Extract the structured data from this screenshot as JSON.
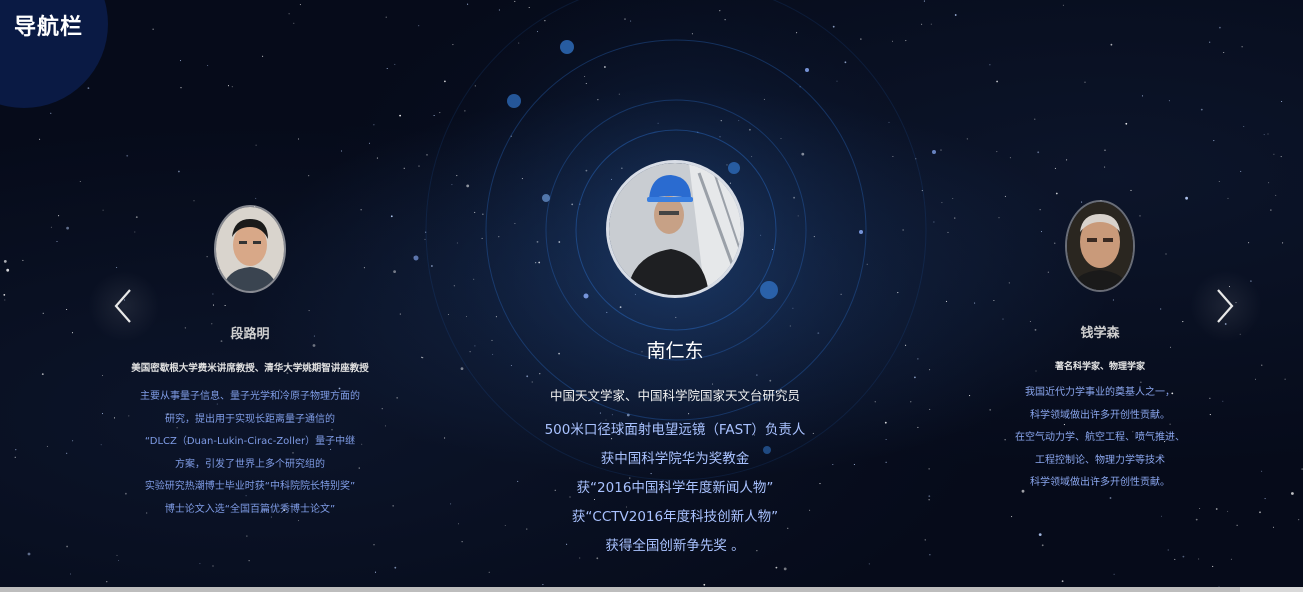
{
  "nav": {
    "title": "导航栏"
  },
  "colors": {
    "background": "#060b1a",
    "nav_badge": "#0a1a44",
    "desc_text": "#a9c2ff",
    "orbit": "#2a6cc8"
  },
  "icons": {
    "prev": "chevron-left-icon",
    "next": "chevron-right-icon"
  },
  "cards": {
    "left": {
      "name": "段路明",
      "role": "美国密歇根大学费米讲席教授、清华大学姚期智讲座教授",
      "desc": [
        "主要从事量子信息、量子光学和冷原子物理方面的",
        "研究，提出用于实现长距离量子通信的",
        "“DLCZ（Duan-Lukin-Cirac-Zoller）量子中继",
        "方案，引发了世界上多个研究组的",
        "实验研究热潮博士毕业时获“中科院院长特别奖”",
        "博士论文入选“全国百篇优秀博士论文”"
      ]
    },
    "center": {
      "name": "南仁东",
      "role": "中国天文学家、中国科学院国家天文台研究员",
      "desc": [
        "500米口径球面射电望远镜（FAST）负责人",
        "获中国科学院华为奖教金",
        "获“2016中国科学年度新闻人物”",
        "获“CCTV2016年度科技创新人物”",
        "获得全国创新争先奖 。"
      ]
    },
    "right": {
      "name": "钱学森",
      "role": "著名科学家、物理学家",
      "desc": [
        "我国近代力学事业的奠基人之一，",
        "科学领域做出许多开创性贡献。",
        "在空气动力学、航空工程、喷气推进、",
        "工程控制论、物理力学等技术",
        "科学领域做出许多开创性贡献。"
      ]
    }
  }
}
